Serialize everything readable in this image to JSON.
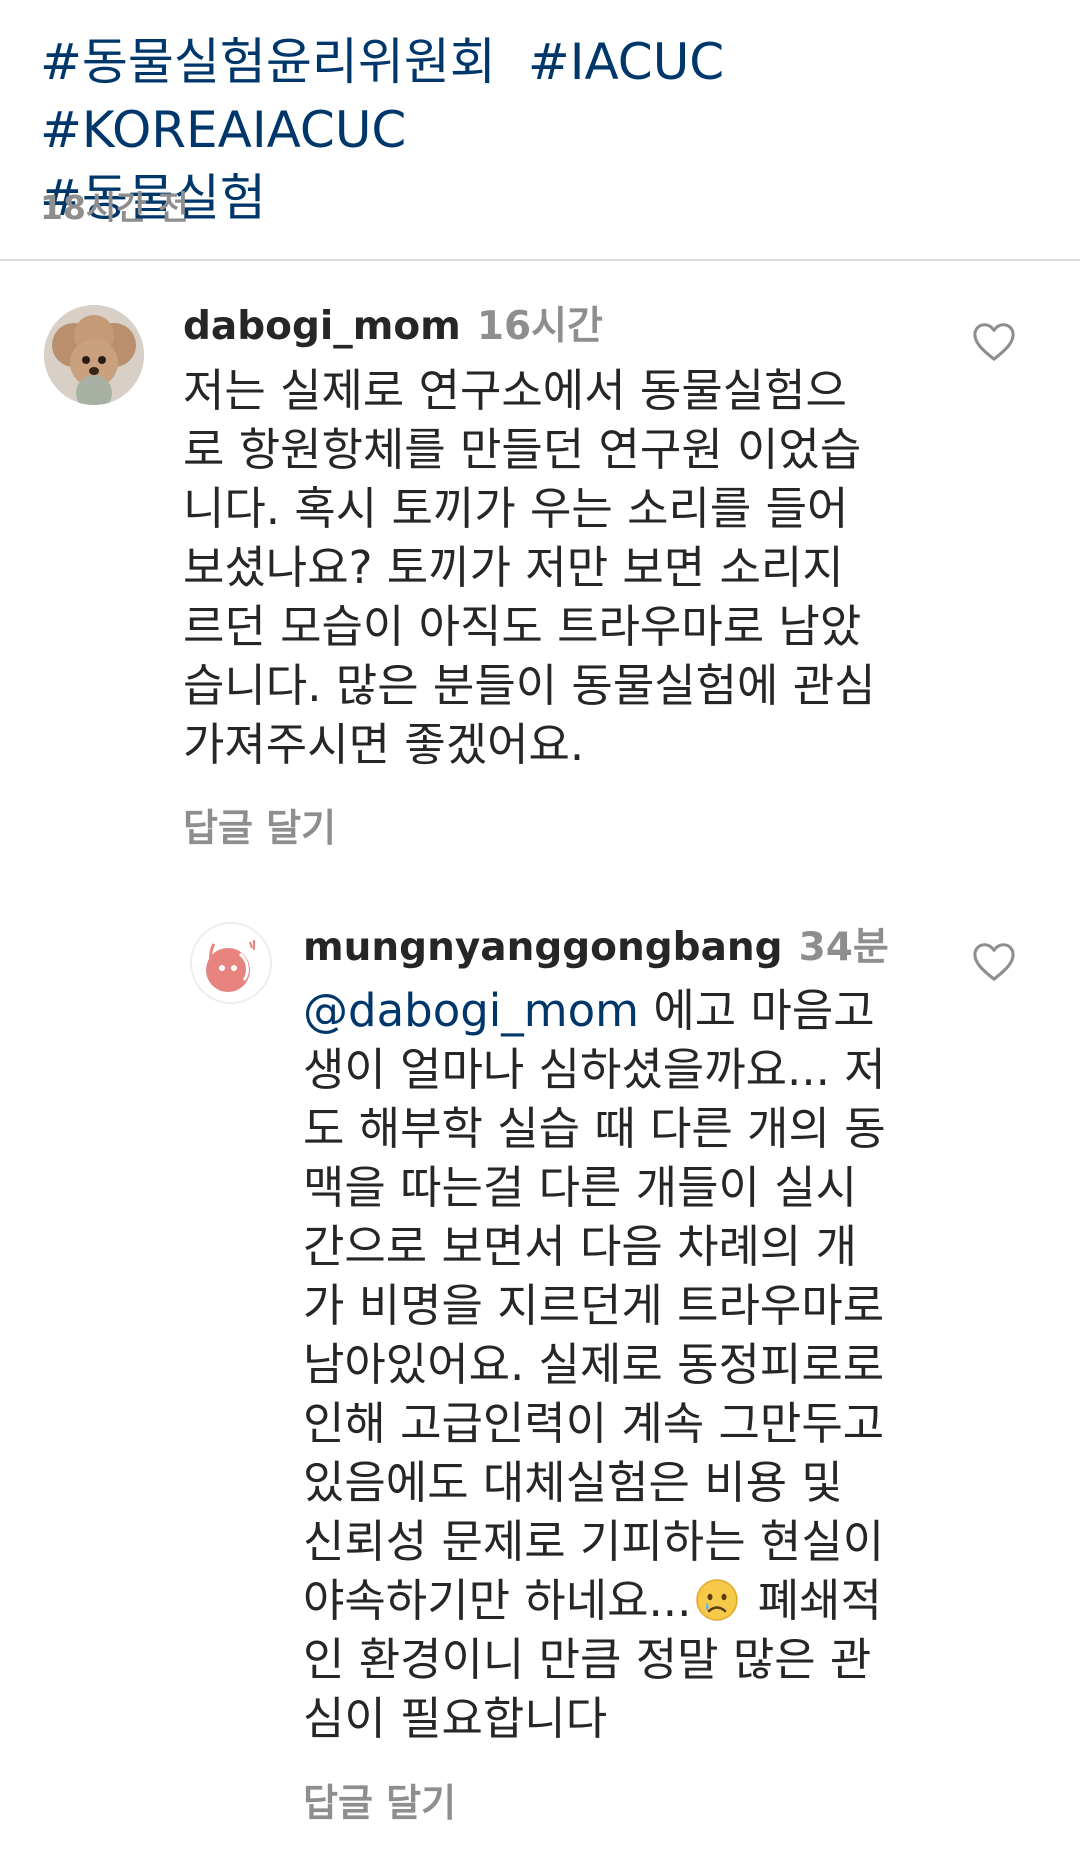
{
  "caption": {
    "hashtags": [
      "#동물실험윤리위원회",
      "#IACUC",
      "#KOREAIACUC",
      "#동물실험"
    ],
    "time": "18시간 전"
  },
  "comments": [
    {
      "username": "dabogi_mom",
      "time": "16시간",
      "avatar_icon": "poodle-dog-avatar",
      "lines": [
        "저는 실제로 연구소에서 동물실험으",
        "로 항원항체를 만들던 연구원 이었습",
        "니다. 혹시 토끼가 우는 소리를 들어",
        "보셨나요? 토끼가 저만 보면 소리지",
        "르던 모습이 아직도 트라우마로 남았",
        "습니다. 많은 분들이 동물실험에 관심",
        "가져주시면 좋겠어요."
      ],
      "reply_label": "답글 달기"
    },
    {
      "username": "mungnyanggongbang",
      "time": "34분",
      "avatar_icon": "mungnyang-logo-avatar",
      "mention": "@dabogi_mom",
      "first_line_rest": " 에고 마음고",
      "lines": [
        "생이 얼마나 심하셨을까요... 저",
        "도 해부학 실습 때 다른 개의 동",
        "맥을 따는걸 다른 개들이 실시",
        "간으로 보면서 다음 차례의 개",
        "가 비명을 지르던게 트라우마로",
        "남아있어요. 실제로 동정피로로",
        "인해 고급인력이 계속 그만두고",
        "있음에도 대체실험은 비용 및",
        "신뢰성 문제로 기피하는 현실이"
      ],
      "emoji_line_before": "야속하기만 하네요...",
      "emoji_icon": "crying-face-emoji",
      "emoji_line_after": " 폐쇄적",
      "lines_after": [
        "인 환경이니 만큼 정말 많은 관",
        "심이 필요합니다"
      ],
      "reply_label": "답글 달기"
    }
  ],
  "icons": {
    "like": "heart-outline-icon"
  },
  "colors": {
    "link": "#00376b",
    "text": "#262626",
    "muted": "#8e8e8e",
    "divider": "#dbdbdb",
    "logo_pink": "#e8847f"
  }
}
